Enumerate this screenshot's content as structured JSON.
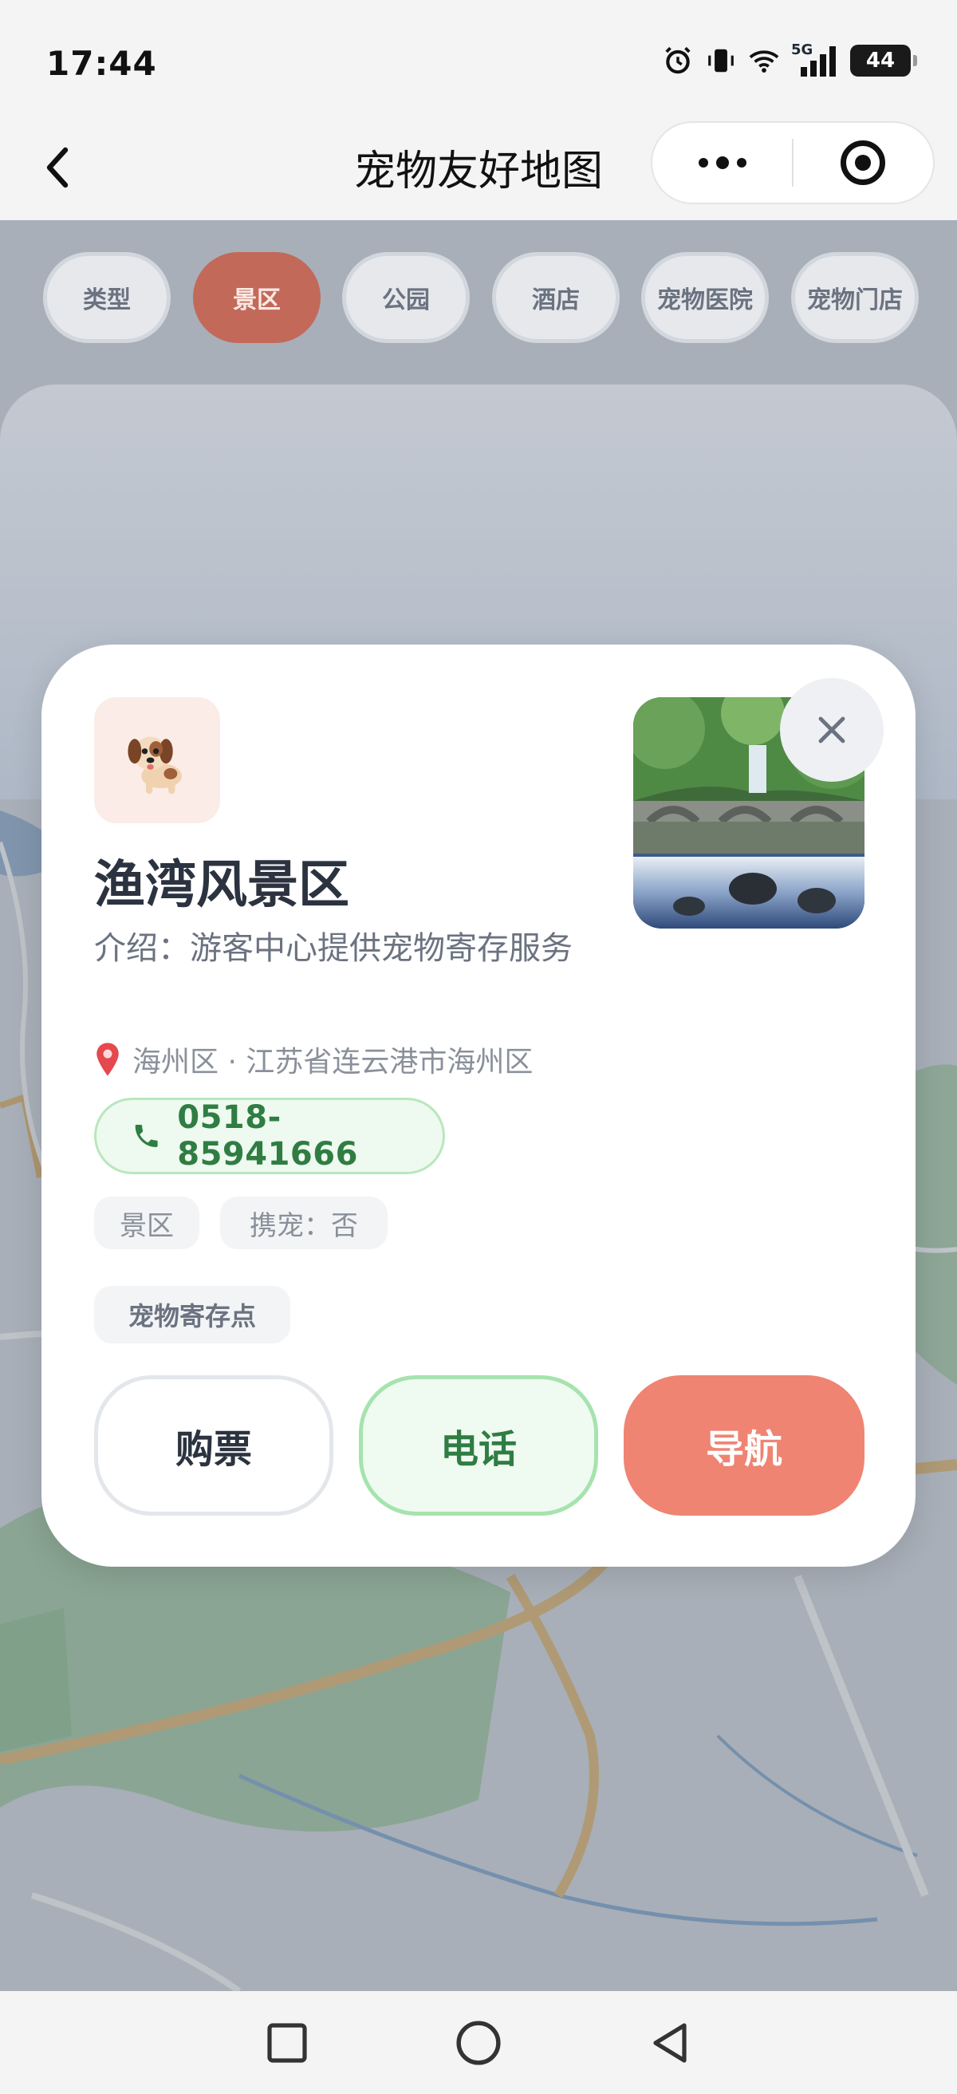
{
  "status_bar": {
    "time": "17:44",
    "network_label": "5G",
    "battery": "44",
    "icons": [
      "alarm-icon",
      "vibrate-icon",
      "wifi-icon",
      "signal-icon",
      "battery-icon"
    ]
  },
  "nav": {
    "title": "宠物友好地图",
    "back_icon": "chevron-left-icon",
    "more_icon": "more-dots-icon",
    "target_icon": "target-icon"
  },
  "filters": [
    {
      "label": "类型",
      "active": false
    },
    {
      "label": "景区",
      "active": true
    },
    {
      "label": "公园",
      "active": false
    },
    {
      "label": "酒店",
      "active": false
    },
    {
      "label": "宠物医院",
      "active": false
    },
    {
      "label": "宠物门店",
      "active": false
    }
  ],
  "card": {
    "avatar_icon": "dog-icon",
    "close_icon": "close-icon",
    "photo_icon": "waterfall-photo",
    "name": "渔湾风景区",
    "intro": "介绍：游客中心提供宠物寄存服务",
    "address_icon": "pin-icon",
    "address": "海州区 · 江苏省连云港市海州区",
    "phone_icon": "phone-icon",
    "phone": "0518-85941666",
    "tags": [
      "景区",
      "携宠：否"
    ],
    "feature_tag": "宠物寄存点",
    "actions": {
      "buy": "购票",
      "call": "电话",
      "navigate": "导航"
    }
  },
  "system_nav": {
    "recent_icon": "square-icon",
    "home_icon": "circle-icon",
    "back_icon": "triangle-back-icon"
  },
  "colors": {
    "active_chip": "#c2695a",
    "navigate_button": "#ef8472",
    "phone_green": "#2f7d43"
  }
}
